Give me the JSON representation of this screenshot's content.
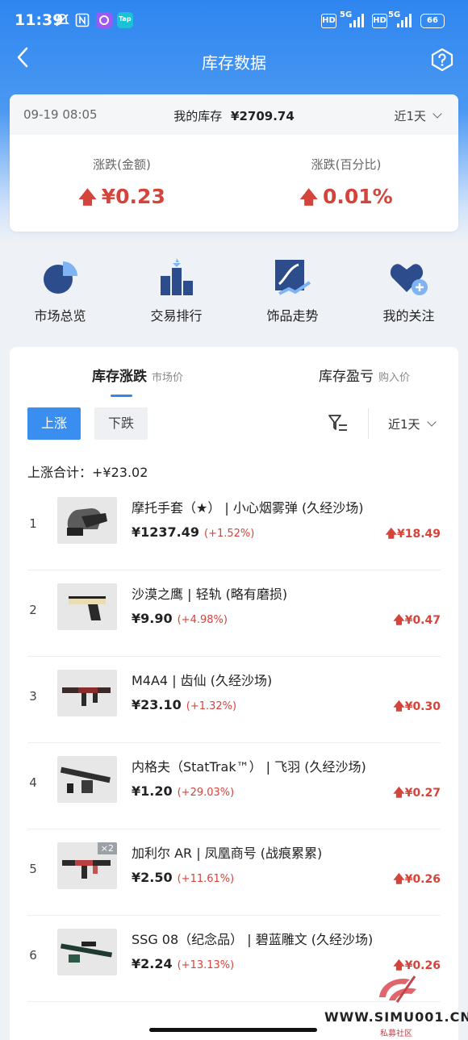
{
  "status_bar": {
    "time": "11:39",
    "hd1": "HD",
    "net1": "5G",
    "hd2": "HD",
    "net2": "5G",
    "battery": "66",
    "tap_label": "Tap"
  },
  "header": {
    "title": "库存数据",
    "back_icon": "chevron-left-icon",
    "help_icon": "help-icon"
  },
  "summary": {
    "date": "09-19 08:05",
    "inventory_label": "我的库存",
    "inventory_value": "¥2709.74",
    "range": "近1天",
    "change_amount_label": "涨跌(金额)",
    "change_amount_value": "¥0.23",
    "change_pct_label": "涨跌(百分比)",
    "change_pct_value": "0.01%",
    "up_color": "#d5443b"
  },
  "menu": [
    {
      "label": "市场总览",
      "icon": "pie-chart-icon"
    },
    {
      "label": "交易排行",
      "icon": "ranking-icon"
    },
    {
      "label": "饰品走势",
      "icon": "trend-icon"
    },
    {
      "label": "我的关注",
      "icon": "heart-plus-icon"
    }
  ],
  "tabs": [
    {
      "label": "库存涨跌",
      "sub": "市场价",
      "active": true
    },
    {
      "label": "库存盈亏",
      "sub": "购入价",
      "active": false
    }
  ],
  "filters": {
    "up_label": "上涨",
    "down_label": "下跌",
    "range": "近1天",
    "filter_icon": "filter-icon"
  },
  "total": {
    "label": "上涨合计：",
    "value": "+¥23.02"
  },
  "items": [
    {
      "rank": "1",
      "name": "摩托手套（★） | 小心烟雾弹 (久经沙场)",
      "price": "¥1237.49",
      "pct": "(+1.52%)",
      "change": "¥18.49",
      "badge": ""
    },
    {
      "rank": "2",
      "name": "沙漠之鹰 | 轻轨 (略有磨损)",
      "price": "¥9.90",
      "pct": "(+4.98%)",
      "change": "¥0.47",
      "badge": ""
    },
    {
      "rank": "3",
      "name": "M4A4 | 齿仙 (久经沙场)",
      "price": "¥23.10",
      "pct": "(+1.32%)",
      "change": "¥0.30",
      "badge": ""
    },
    {
      "rank": "4",
      "name": "内格夫（StatTrak™） | 飞羽 (久经沙场)",
      "price": "¥1.20",
      "pct": "(+29.03%)",
      "change": "¥0.27",
      "badge": ""
    },
    {
      "rank": "5",
      "name": "加利尔 AR | 凤凰商号 (战痕累累)",
      "price": "¥2.50",
      "pct": "(+11.61%)",
      "change": "¥0.26",
      "badge": "×2"
    },
    {
      "rank": "6",
      "name": "SSG 08（纪念品） | 碧蓝雕文 (久经沙场)",
      "price": "¥2.24",
      "pct": "(+13.13%)",
      "change": "¥0.26",
      "badge": ""
    }
  ],
  "watermark": {
    "site": "WWW.SIMU001.CN",
    "cn": "私募社区"
  }
}
